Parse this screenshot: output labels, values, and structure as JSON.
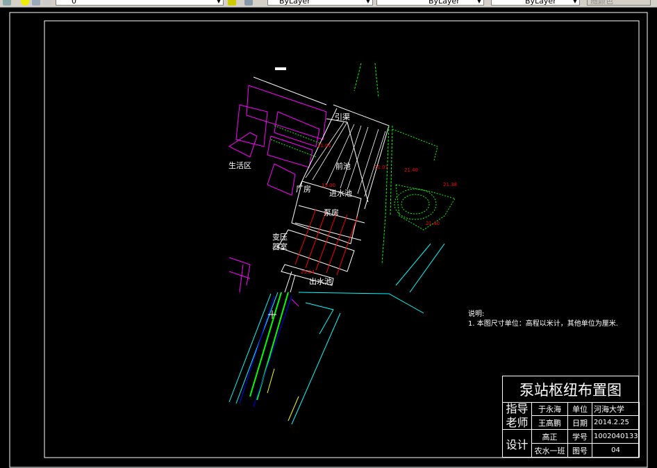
{
  "toolbar": {
    "layer_value": "0",
    "color_value": "ByLayer",
    "linetype_value": "ByLayer",
    "lineweight_value": "ByLayer",
    "plotstyle_value": "随颜色"
  },
  "drawing": {
    "area_labels": {
      "intake_channel": "引渠",
      "forebay": "前池",
      "living_area": "生活区",
      "plant": "厂房",
      "inlet_pool": "进水池",
      "pump_house": "泵房",
      "transformer_room_1": "变压",
      "transformer_room_2": "器室",
      "outlet_pool": "出水池"
    },
    "elevations": [
      "15.00",
      "21.01",
      "21.01",
      "21.40",
      "21.38",
      "21.40",
      "25.04"
    ],
    "notes": {
      "title": "说明:",
      "line1": "1. 本图尺寸单位：高程以米计，其他单位为厘米."
    }
  },
  "title_block": {
    "title": "泵站枢纽布置图",
    "advisor_label_1": "指导",
    "advisor_label_2": "老师",
    "advisor_name": "于永海",
    "reviewer_name": "王高鹏",
    "design_label": "设计",
    "designer_name": "高正",
    "class_name": "农水一班",
    "unit_label": "单位",
    "unit_value": "河海大学",
    "date_label": "日期",
    "date_value": "2014.2.25",
    "student_id_label": "学号",
    "student_id_value": "1002040133",
    "drawing_no_label": "图号",
    "drawing_no_value": "04"
  },
  "colors": {
    "background": "#000000",
    "building": "#ff00ff",
    "structure": "#ffffff",
    "vegetation": "#00ff00",
    "road": "#00ffff",
    "elevation": "#ff0000",
    "pipe": "#0000ff"
  }
}
